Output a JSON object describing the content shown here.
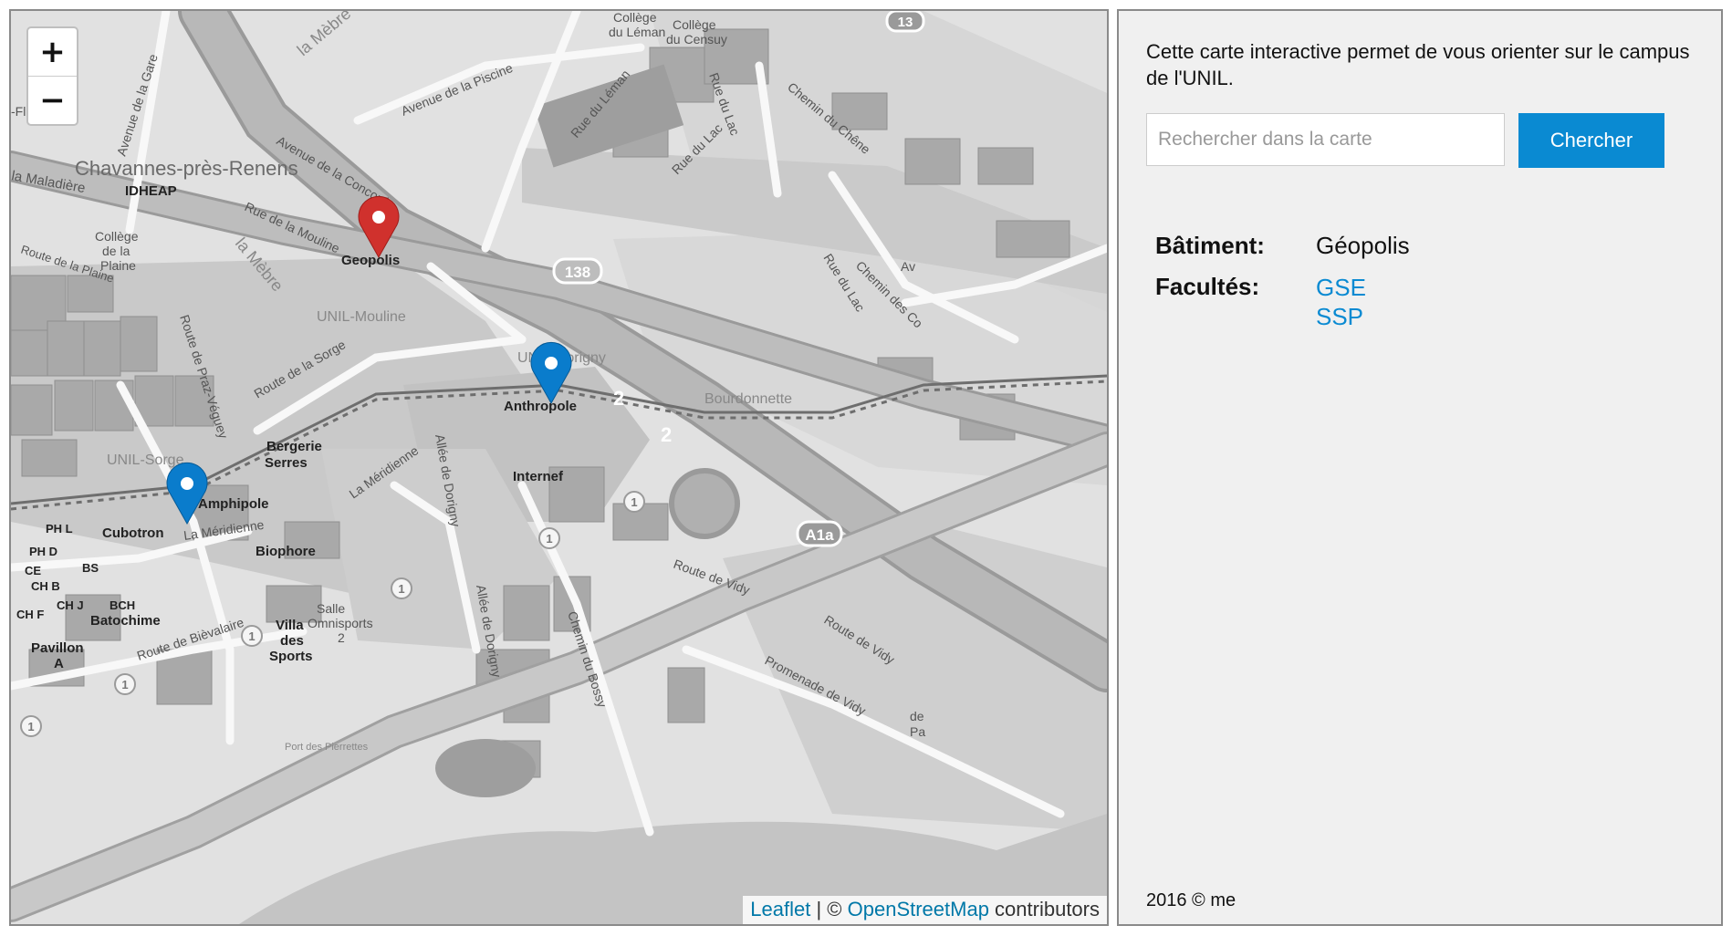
{
  "map": {
    "zoom_in": "+",
    "zoom_out": "−",
    "labels": {
      "chavannes": "Chavannes-près-Renens",
      "maladiere": "la Maladière",
      "idheap": "IDHEAP",
      "college_plaine": [
        "Collège",
        "de la",
        "Plaine"
      ],
      "route_plaine": "Route de la Plaine",
      "fleuri": "-Fleuri",
      "av_gare": "Avenue de la Gare",
      "av_piscine": "Avenue de la Piscine",
      "av_concorde": "Avenue de la Concorde",
      "rue_mouline": "Rue de la Mouline",
      "la_mebre": "la Mèbre",
      "mebre_top": "la Mèbre",
      "college_leman": [
        "Collège",
        "du Léman"
      ],
      "college_censuy": [
        "Collège",
        "du Censuy"
      ],
      "rue_leman": "Rue du Léman",
      "rue_lac": "Rue du Lac",
      "rue_lac2": "Rue du Lac",
      "rue_lac3": "Rue du Lac",
      "ch_chene": "Chemin du Chêne",
      "ch_des_co": "Chemin des Co",
      "av_edge": "Av",
      "road_138": "138",
      "road_13": "13",
      "unil_mouline": "UNIL-Mouline",
      "route_sorge": "Route de la Sorge",
      "route_praz": "Route de Praz-Véguey",
      "unil_dorigny": "UNIL-Dorigny",
      "bourdonnette": "Bourdonnette",
      "bergerie": [
        "Bergerie",
        "Serres"
      ],
      "unil_sorge": "UNIL-Sorge",
      "meridienne": "La Méridienne",
      "meridienne2": "La Méridienne",
      "allee_dorigny": "Allée de Dorigny",
      "allee_dorigny2": "Allée de Dorigny",
      "internef": "Internef",
      "cubotron": "Cubotron",
      "biophore": "Biophore",
      "phl": "PH L",
      "phd": "PH D",
      "ce": "CE",
      "bs": "BS",
      "chb": "CH B",
      "chj": "CH J",
      "bch": "BCH",
      "chf": "CH F",
      "batochime": "Batochime",
      "pavillon": [
        "Pavillon",
        "A"
      ],
      "villa": [
        "Villa",
        "des",
        "Sports"
      ],
      "salle": [
        "Salle",
        "Omnisports",
        "2"
      ],
      "route_bievalaire": "Route de Bièvalaire",
      "route_vidy": "Route de Vidy",
      "route_vidy2": "Route de Vidy",
      "promenade_vidy": "Promenade de Vidy",
      "ch_bossy": "Chemin du Bossy",
      "a1a": "A1a",
      "road_2a": "2",
      "road_2b": "2",
      "road_1": "1",
      "port": "Port des Pierrettes",
      "pa": "Pa",
      "de": "de"
    },
    "markers": [
      {
        "name": "Geopolis",
        "color": "#d0312d"
      },
      {
        "name": "Anthropole",
        "color": "#0a7ccc"
      },
      {
        "name": "Amphipole",
        "color": "#0a7ccc"
      }
    ],
    "attribution": {
      "leaflet": "Leaflet",
      "sep": " | © ",
      "osm": "OpenStreetMap",
      "contributors": " contributors"
    }
  },
  "sidebar": {
    "intro": "Cette carte interactive permet de vous orienter sur le campus de l'UNIL.",
    "search_placeholder": "Rechercher dans la carte",
    "search_button": "Chercher",
    "building_label": "Bâtiment:",
    "building_value": "Géopolis",
    "faculties_label": "Facultés:",
    "faculties": [
      "GSE",
      "SSP"
    ],
    "footer": "2016 © me"
  },
  "colors": {
    "accent": "#0a8ad2",
    "marker_selected": "#d0312d",
    "marker_default": "#0a7ccc"
  }
}
